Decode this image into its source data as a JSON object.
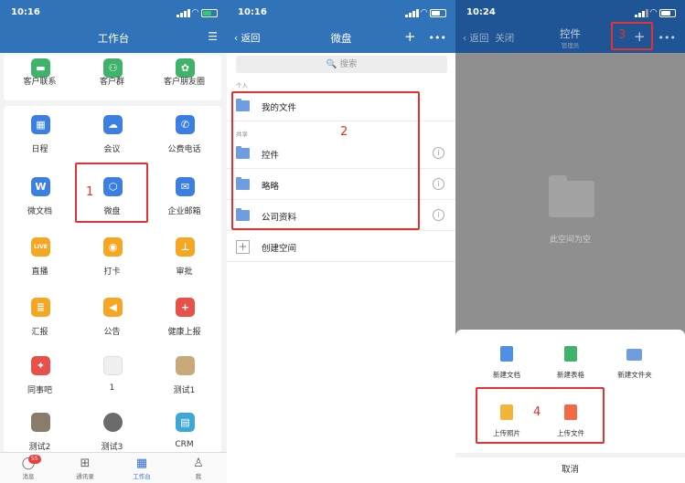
{
  "panel1": {
    "time": "10:16",
    "title": "工作台",
    "top_row": [
      "客户联系",
      "客户群",
      "客户朋友圈"
    ],
    "grid": [
      {
        "label": "日程",
        "icon": "calendar-icon",
        "color": "#3b7fe0",
        "glyph": "▦"
      },
      {
        "label": "会议",
        "icon": "meeting-icon",
        "color": "#3b7fe0",
        "glyph": "☁"
      },
      {
        "label": "公费电话",
        "icon": "phone-icon",
        "color": "#3b7fe0",
        "glyph": "✆"
      },
      {
        "label": "微文档",
        "icon": "document-icon",
        "color": "#3b7fe0",
        "glyph": "W"
      },
      {
        "label": "微盘",
        "icon": "weipan-icon",
        "color": "#3b7fe0",
        "glyph": "⬡"
      },
      {
        "label": "企业邮箱",
        "icon": "mail-icon",
        "color": "#3b7fe0",
        "glyph": "✉"
      },
      {
        "label": "直播",
        "icon": "live-icon",
        "color": "#f5a623",
        "glyph": "LIVE"
      },
      {
        "label": "打卡",
        "icon": "checkin-icon",
        "color": "#f5a623",
        "glyph": "◉"
      },
      {
        "label": "审批",
        "icon": "approval-icon",
        "color": "#f5a623",
        "glyph": "⊥"
      },
      {
        "label": "汇报",
        "icon": "report-icon",
        "color": "#f5a623",
        "glyph": "≣"
      },
      {
        "label": "公告",
        "icon": "announcement-icon",
        "color": "#f5a623",
        "glyph": "◀"
      },
      {
        "label": "健康上报",
        "icon": "health-icon",
        "color": "#e6514a",
        "glyph": "+"
      },
      {
        "label": "同事吧",
        "icon": "colleague-icon",
        "color": "#e6514a",
        "glyph": "✦"
      },
      {
        "label": "1",
        "icon": "app-thumbnail-icon",
        "color": "#e8e8e8",
        "glyph": ""
      },
      {
        "label": "测试1",
        "icon": "app-thumbnail-icon",
        "color": "#c9a97a",
        "glyph": ""
      },
      {
        "label": "测试2",
        "icon": "app-thumbnail-icon",
        "color": "#8a7b6a",
        "glyph": ""
      },
      {
        "label": "测试3",
        "icon": "app-thumbnail-icon",
        "color": "#6b6b6b",
        "glyph": ""
      },
      {
        "label": "CRM",
        "icon": "crm-icon",
        "color": "#3fa7d6",
        "glyph": "▤"
      }
    ],
    "tabs": [
      {
        "label": "消息",
        "glyph": "◯",
        "icon": "message-icon"
      },
      {
        "label": "通讯录",
        "glyph": "⊞",
        "icon": "contacts-icon"
      },
      {
        "label": "工作台",
        "glyph": "▦",
        "icon": "workbench-icon"
      },
      {
        "label": "我",
        "glyph": "♙",
        "icon": "me-icon"
      }
    ],
    "badge": "55",
    "step": "1"
  },
  "panel2": {
    "time": "10:16",
    "back": "‹ 返回",
    "title": "微盘",
    "search": "🔍 搜索",
    "section_personal": "个人",
    "my_files": "我的文件",
    "section_shared": "共享",
    "shared": [
      "控件",
      "略略",
      "公司资料"
    ],
    "create_space": "创建空间",
    "step": "2"
  },
  "panel3": {
    "time": "10:24",
    "back": "‹ 返回",
    "close": "关闭",
    "title": "控件",
    "subtitle": "管理员",
    "empty": "此空间为空",
    "sheet_row1": [
      "新建文档",
      "新建表格",
      "新建文件夹"
    ],
    "sheet_row2": [
      "上传照片",
      "上传文件"
    ],
    "cancel": "取消",
    "step3": "3",
    "step4": "4"
  }
}
